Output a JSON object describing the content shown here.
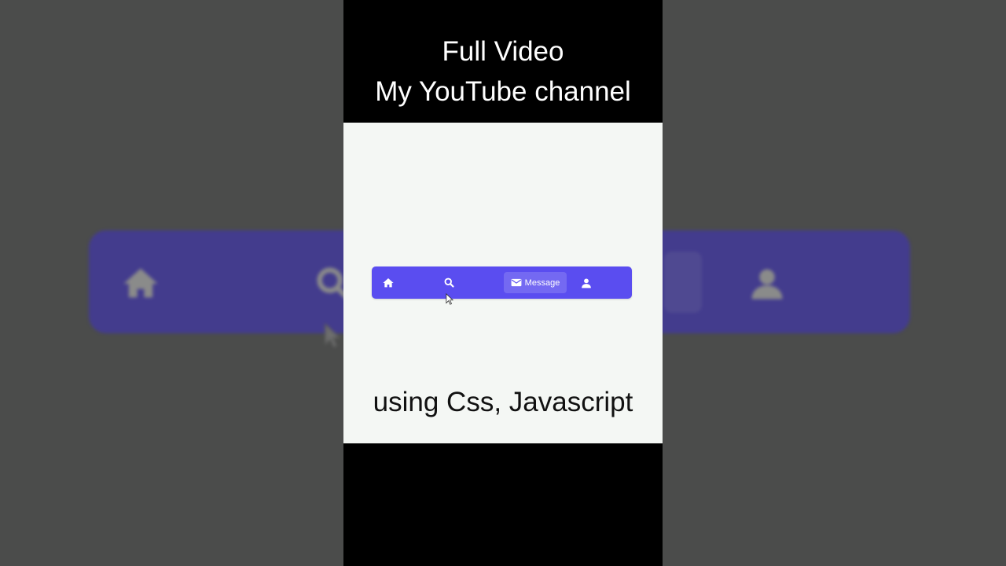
{
  "video": {
    "title_line1": "Full Video",
    "title_line2": "My YouTube channel",
    "caption": "using Css, Javascript"
  },
  "navbar": {
    "accent_color": "#5a4df0",
    "items": [
      {
        "icon": "home-icon",
        "label": ""
      },
      {
        "icon": "search-icon",
        "label": ""
      },
      {
        "icon": "envelope-icon",
        "label": "Message",
        "active": true
      },
      {
        "icon": "user-icon",
        "label": ""
      }
    ]
  },
  "colors": {
    "background": "#4b4c4b",
    "panel_content": "#f4f7f4",
    "bars": "#000000"
  }
}
